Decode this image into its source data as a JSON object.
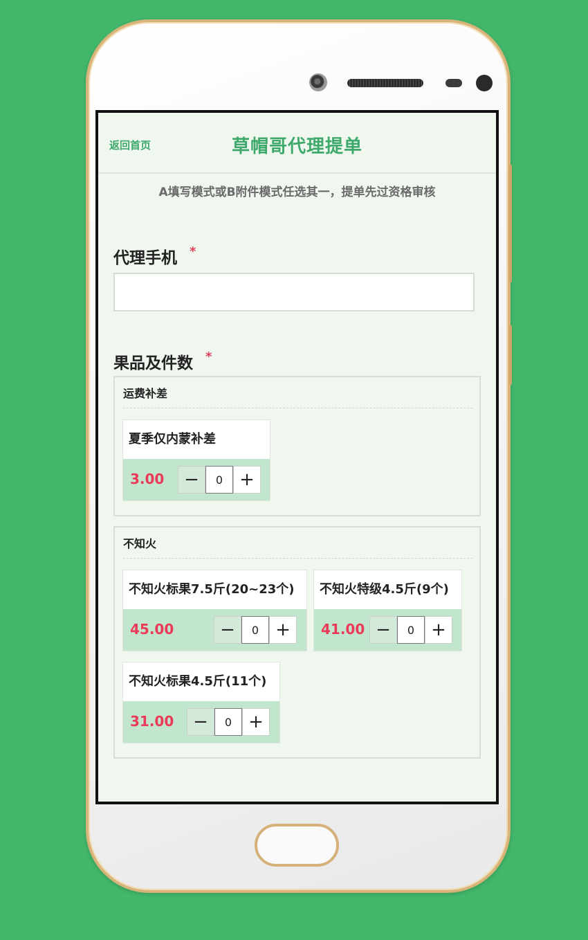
{
  "header": {
    "back_label": "返回首页",
    "title": "草帽哥代理提单"
  },
  "notice": "A填写模式或B附件模式任选其一，提单先过资格审核",
  "form": {
    "phone_label": "代理手机",
    "phone_required": "*",
    "phone_value": "",
    "products_label": "果品及件数",
    "products_required": "*"
  },
  "groups": [
    {
      "title": "运费补差",
      "items": [
        {
          "name": "夏季仅内蒙补差",
          "price": "3.00",
          "qty": "0"
        }
      ]
    },
    {
      "title": "不知火",
      "items": [
        {
          "name": "不知火标果7.5斤(20~23个)",
          "price": "45.00",
          "qty": "0"
        },
        {
          "name": "不知火特级4.5斤(9个)",
          "price": "41.00",
          "qty": "0"
        },
        {
          "name": "不知火标果4.5斤(11个)",
          "price": "31.00",
          "qty": "0"
        }
      ]
    }
  ],
  "icons": {
    "minus": "minus-icon",
    "plus": "plus-icon"
  },
  "colors": {
    "background": "#42b66a",
    "accent": "#3ea96a",
    "price": "#ea3a57",
    "card_footer": "#c1e6cd"
  }
}
